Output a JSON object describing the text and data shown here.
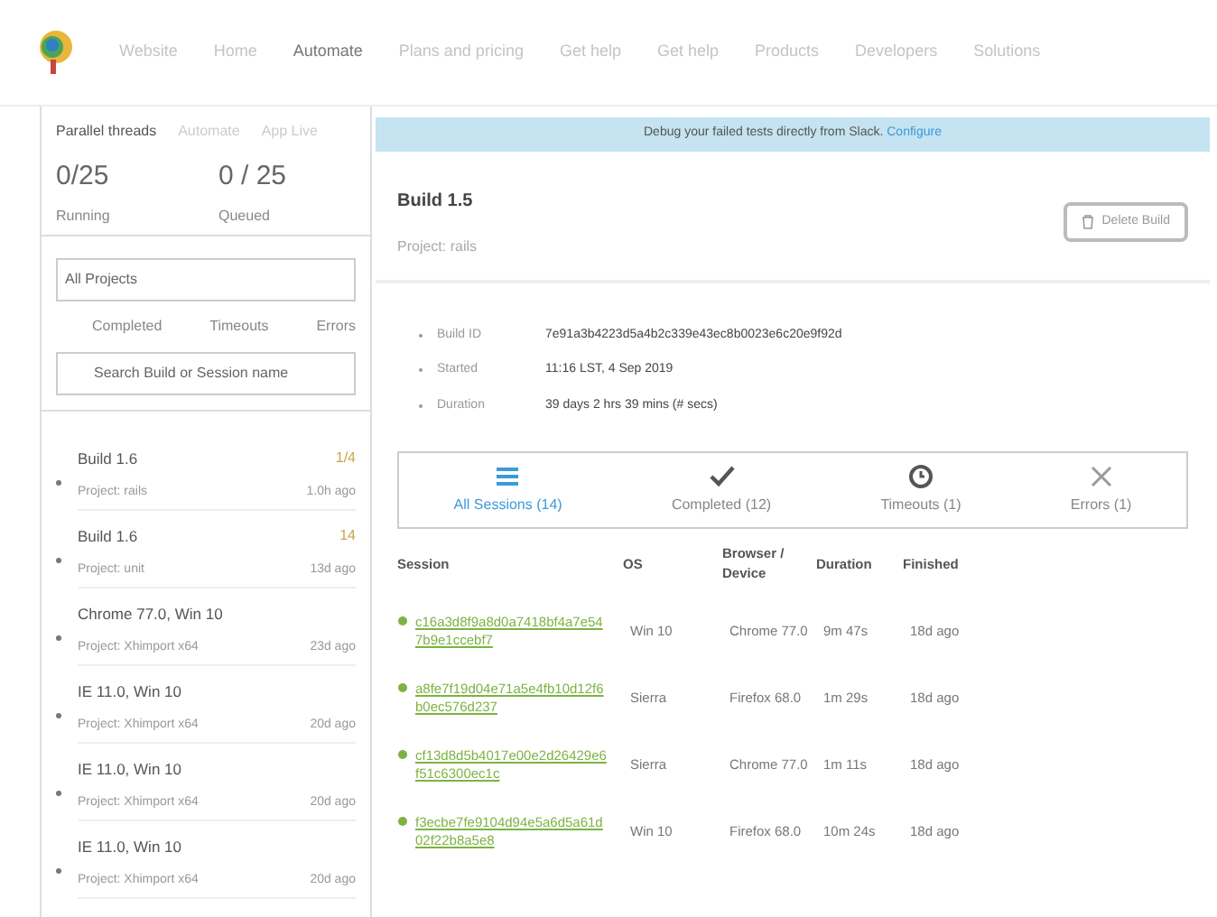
{
  "nav": {
    "items": [
      {
        "label": "Website"
      },
      {
        "label": "Home"
      },
      {
        "label": "Automate"
      },
      {
        "label": "Plans and pricing"
      },
      {
        "label": "Get help"
      },
      {
        "label": "Get help"
      },
      {
        "label": "Products"
      },
      {
        "label": "Developers"
      },
      {
        "label": "Solutions"
      }
    ]
  },
  "sidebar": {
    "parallel": {
      "title": "Parallel threads",
      "tabs": [
        {
          "label": "Automate",
          "selected": false
        },
        {
          "label": "App Live",
          "selected": false
        }
      ],
      "running": "0/25",
      "running_label": "Running",
      "queued": "0 / 25",
      "queued_label": "Queued"
    },
    "project_filter": "All Projects",
    "filters": [
      {
        "label": "Completed"
      },
      {
        "label": "Timeouts"
      },
      {
        "label": "Errors"
      }
    ],
    "search": {
      "placeholder": "Search Build or Session name"
    },
    "builds": [
      {
        "name": "Build 1.6",
        "project": "Project: rails",
        "time": "1.0h ago",
        "count": "1/4",
        "color": "#c8a64a"
      },
      {
        "name": "Build 1.6",
        "project": "Project: unit",
        "time": "13d ago",
        "count": "14",
        "color": "#c8a64a"
      },
      {
        "name": "Chrome 77.0, Win 10",
        "project": "Project: Xhimport x64",
        "time": "23d ago"
      },
      {
        "name": "IE 11.0, Win 10",
        "project": "Project: Xhimport x64",
        "time": "20d ago"
      },
      {
        "name": "IE 11.0, Win 10",
        "project": "Project: Xhimport x64",
        "time": "20d ago"
      },
      {
        "name": "IE 11.0, Win 10",
        "project": "Project: Xhimport x64",
        "time": "20d ago"
      }
    ]
  },
  "banner": {
    "text": "Debug your failed tests directly from Slack.",
    "link": "Configure"
  },
  "build": {
    "title": "Build 1.5",
    "project": "Project: rails",
    "delete_button": "Delete Build",
    "details": [
      {
        "label": "Build ID",
        "value": "7e91a3b4223d5a4b2c339e43ec8b0023e6c20e9f92d"
      },
      {
        "label": "Started",
        "value": "11:16 LST, 4 Sep 2019"
      },
      {
        "label": "Duration",
        "value": "39 days 2 hrs 39 mins (# secs)"
      }
    ]
  },
  "session_tabs": [
    {
      "kind": "list",
      "label": "All Sessions (14)",
      "selected": true
    },
    {
      "kind": "check",
      "label": "Completed (12)",
      "selected": false
    },
    {
      "kind": "clock",
      "label": "Timeouts (1)",
      "selected": false
    },
    {
      "kind": "cross",
      "label": "Errors (1)",
      "selected": false
    }
  ],
  "table": {
    "columns": [
      "Session",
      "OS",
      "Browser / Device",
      "Duration",
      "Finished"
    ],
    "rows": [
      [
        "c16a3d8f9a8d0a7418bf4a7e547b9e1ccebf7",
        "Win 10",
        "Chrome 77.0",
        "9m 47s",
        "18d ago"
      ],
      [
        "a8fe7f19d04e71a5e4fb10d12f6b0ec576d237",
        "Sierra",
        "Firefox 68.0",
        "1m 29s",
        "18d ago"
      ],
      [
        "cf13d8d5b4017e00e2d26429e6f51c6300ec1c",
        "Sierra",
        "Chrome 77.0",
        "1m 11s",
        "18d ago"
      ],
      [
        "f3ecbe7fe9104d94e5a6d5a61d02f22b8a5e8",
        "Win 10",
        "Firefox 68.0",
        "10m 24s",
        "18d ago"
      ]
    ]
  }
}
